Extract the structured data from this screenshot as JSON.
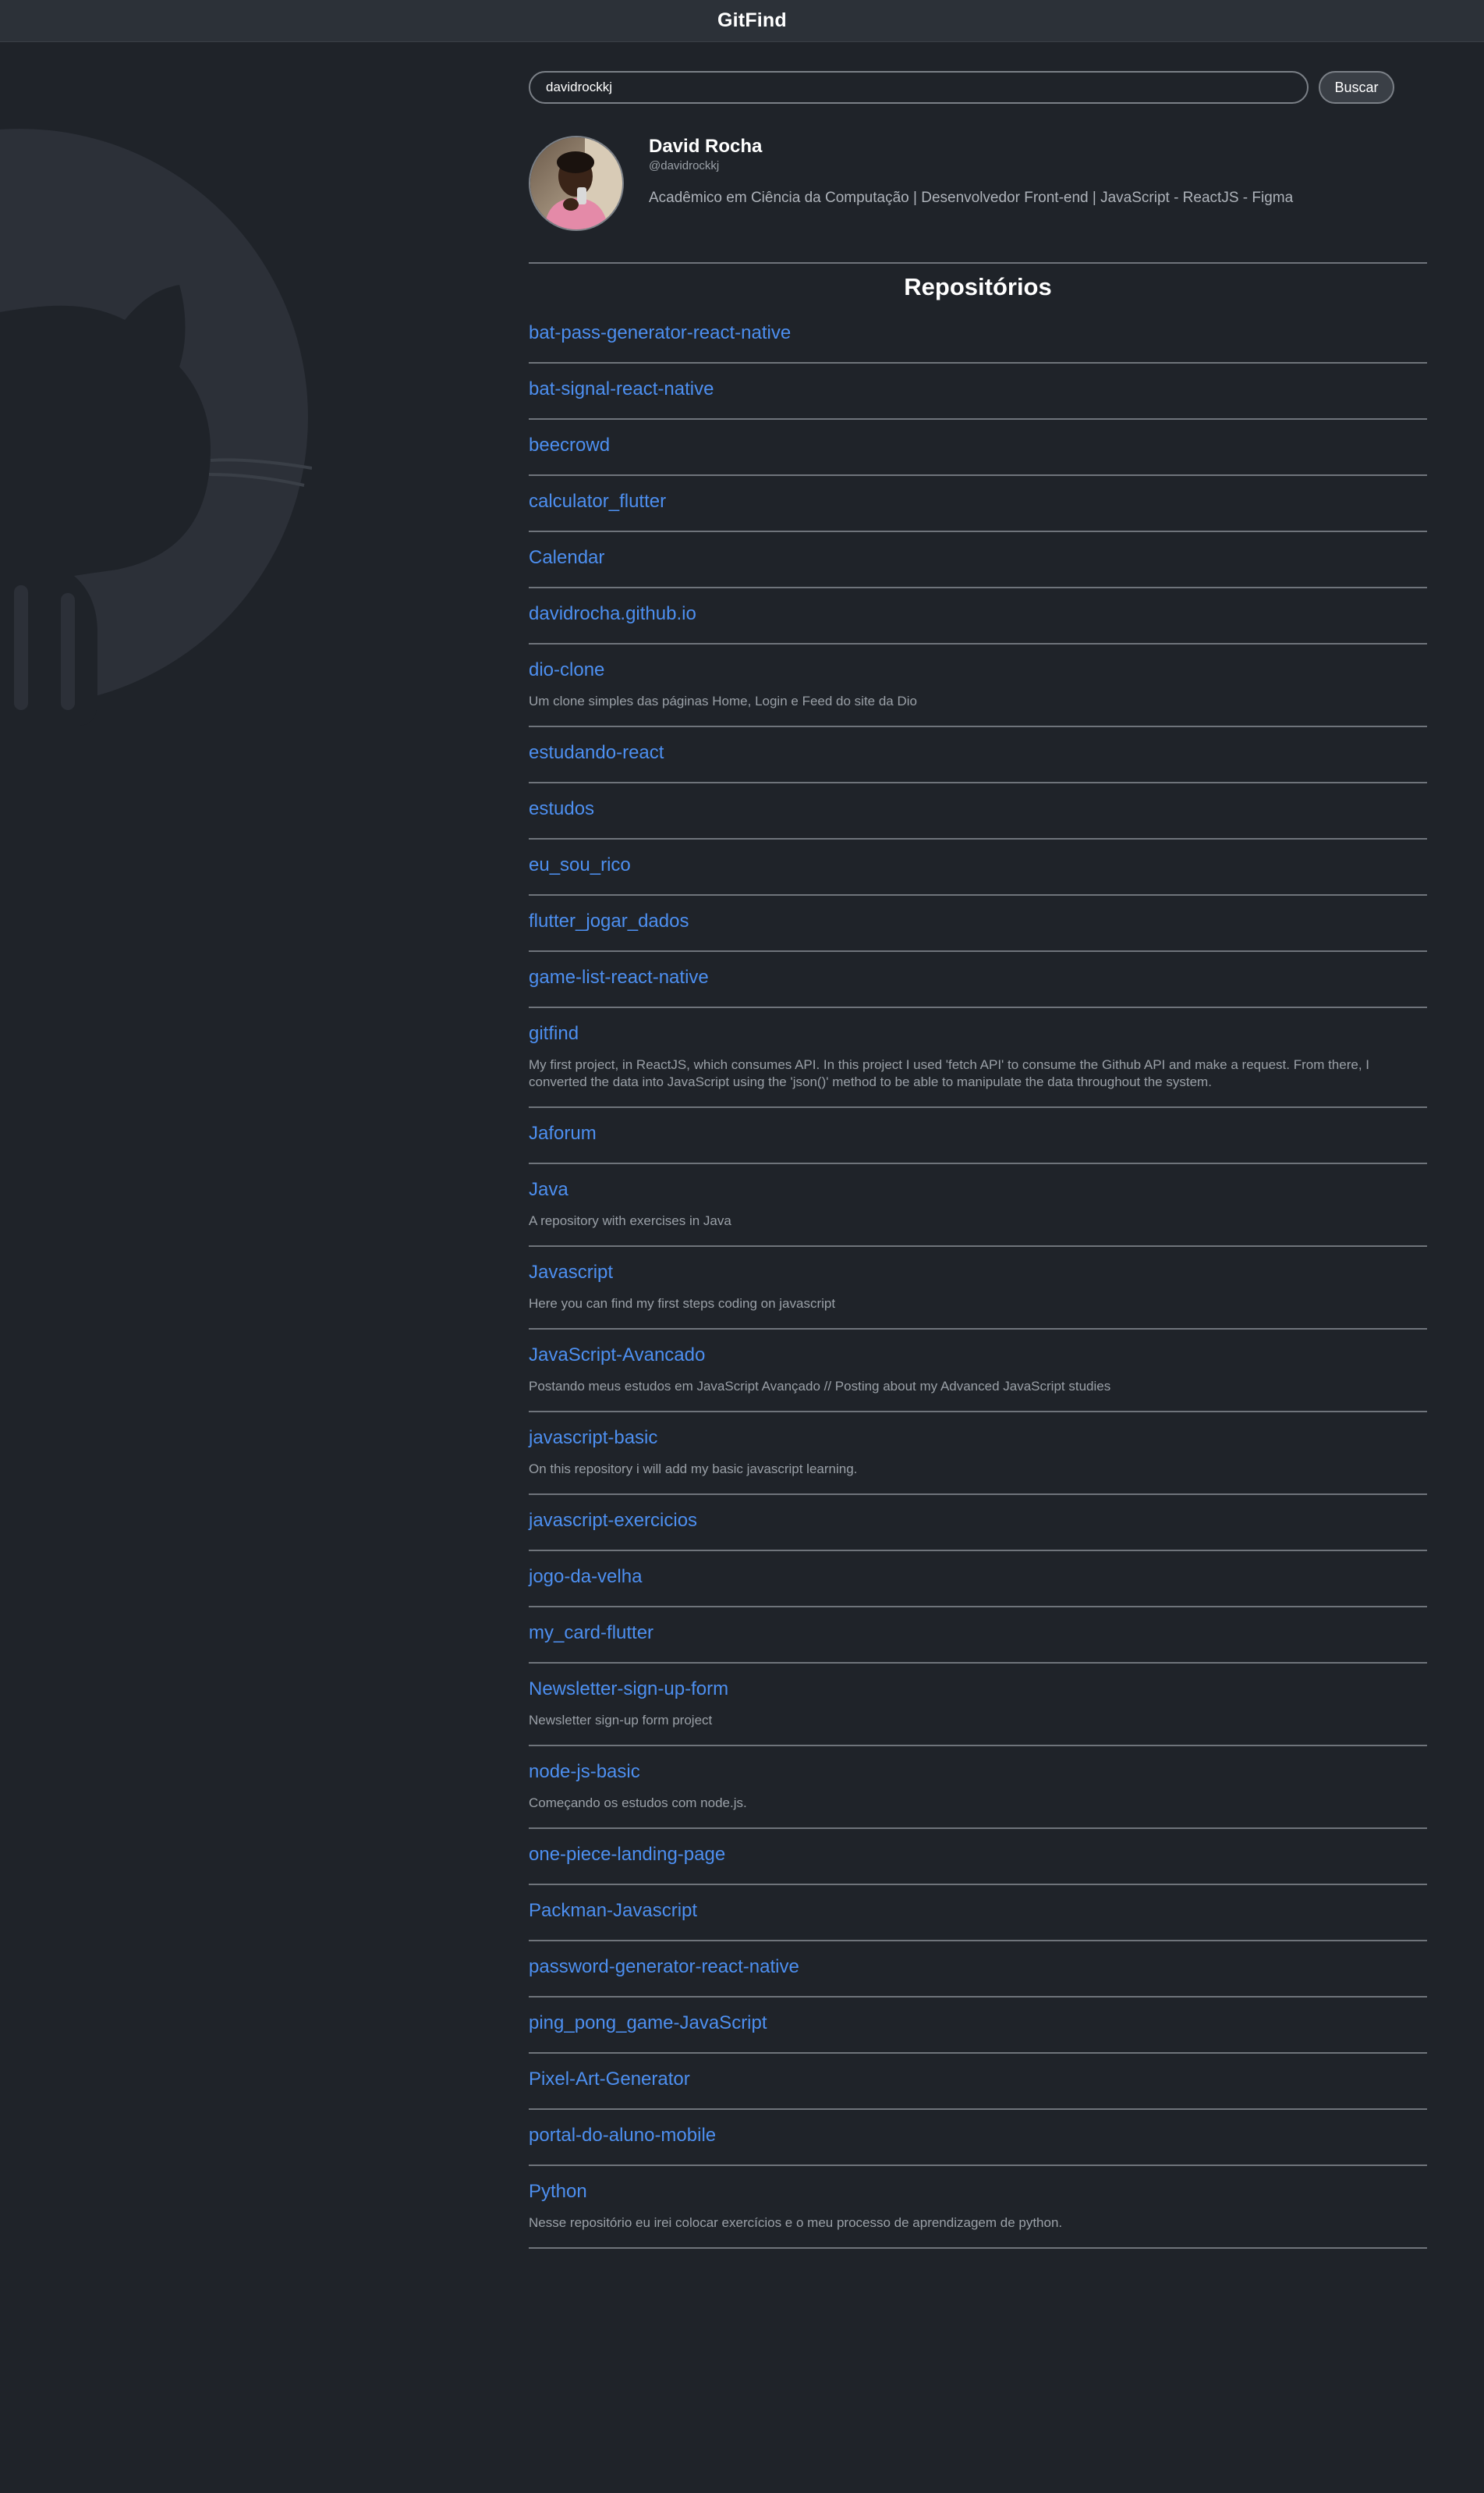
{
  "header": {
    "title": "GitFind"
  },
  "search": {
    "value": "davidrockkj",
    "button_label": "Buscar"
  },
  "profile": {
    "name": "David Rocha",
    "login": "@davidrockkj",
    "bio": "Acadêmico em Ciência da Computação | Desenvolvedor Front-end | JavaScript - ReactJS - Figma"
  },
  "repos_section": {
    "title": "Repositórios"
  },
  "repos": [
    {
      "name": "bat-pass-generator-react-native",
      "description": ""
    },
    {
      "name": "bat-signal-react-native",
      "description": ""
    },
    {
      "name": "beecrowd",
      "description": ""
    },
    {
      "name": "calculator_flutter",
      "description": ""
    },
    {
      "name": "Calendar",
      "description": ""
    },
    {
      "name": "davidrocha.github.io",
      "description": ""
    },
    {
      "name": "dio-clone",
      "description": "Um clone simples das páginas Home, Login e Feed do site da Dio"
    },
    {
      "name": "estudando-react",
      "description": ""
    },
    {
      "name": "estudos",
      "description": ""
    },
    {
      "name": "eu_sou_rico",
      "description": ""
    },
    {
      "name": "flutter_jogar_dados",
      "description": ""
    },
    {
      "name": "game-list-react-native",
      "description": ""
    },
    {
      "name": "gitfind",
      "description": "My first project, in ReactJS, which consumes API. In this project I used 'fetch API' to consume the Github API and make a request. From there, I converted the data into JavaScript using the 'json()' method to be able to manipulate the data throughout the system."
    },
    {
      "name": "Jaforum",
      "description": ""
    },
    {
      "name": "Java",
      "description": "A repository with exercises in Java"
    },
    {
      "name": "Javascript",
      "description": "Here you can find my first steps coding on javascript"
    },
    {
      "name": "JavaScript-Avancado",
      "description": "Postando meus estudos em JavaScript Avançado // Posting about my Advanced JavaScript studies"
    },
    {
      "name": "javascript-basic",
      "description": "On this repository i will add my basic javascript learning."
    },
    {
      "name": "javascript-exercicios",
      "description": ""
    },
    {
      "name": "jogo-da-velha",
      "description": ""
    },
    {
      "name": "my_card-flutter",
      "description": ""
    },
    {
      "name": "Newsletter-sign-up-form",
      "description": "Newsletter sign-up form project"
    },
    {
      "name": "node-js-basic",
      "description": "Começando os estudos com node.js."
    },
    {
      "name": "one-piece-landing-page",
      "description": ""
    },
    {
      "name": "Packman-Javascript",
      "description": ""
    },
    {
      "name": "password-generator-react-native",
      "description": ""
    },
    {
      "name": "ping_pong_game-JavaScript",
      "description": ""
    },
    {
      "name": "Pixel-Art-Generator",
      "description": ""
    },
    {
      "name": "portal-do-aluno-mobile",
      "description": ""
    },
    {
      "name": "Python",
      "description": "Nesse repositório eu irei colocar exercícios e o meu processo de aprendizagem de python."
    }
  ],
  "colors": {
    "background": "#1f2329",
    "topbar": "#2c3138",
    "link": "#4d8ff0",
    "divider": "#6f747b",
    "muted_text": "#9aa0a7"
  },
  "icons": {
    "background_logo": "github-octocat-icon",
    "avatar": "user-avatar-photo"
  }
}
